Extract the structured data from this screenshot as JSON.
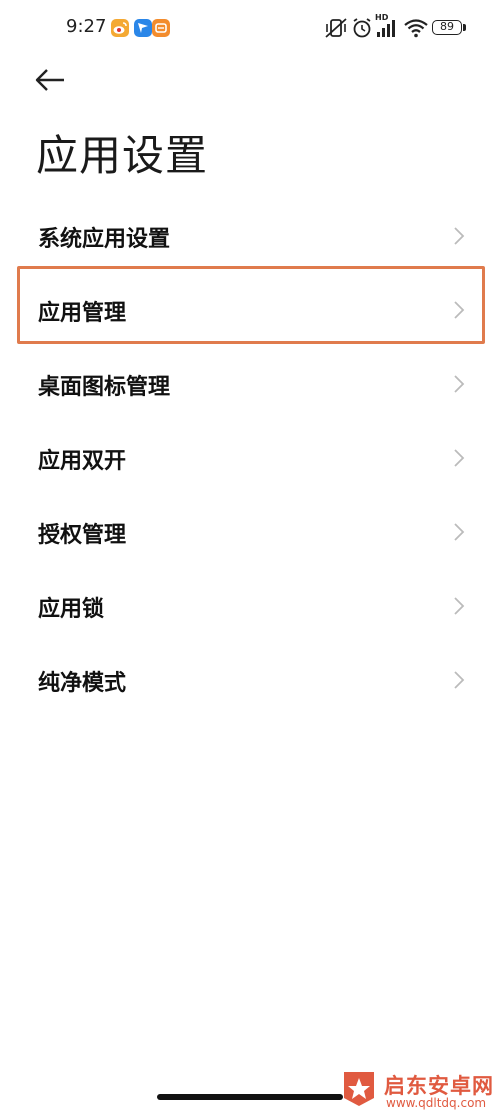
{
  "status_bar": {
    "time": "9:27",
    "battery": "89",
    "network_badge": "HD",
    "notification_icons": [
      "weibo-icon",
      "blue-app-icon",
      "orange-app-icon"
    ],
    "system_icons": [
      "vibrate-off-icon",
      "alarm-icon",
      "signal-icon",
      "wifi-icon",
      "battery-icon"
    ]
  },
  "header": {
    "back_icon": "back-arrow-icon",
    "title": "应用设置"
  },
  "menu": {
    "items": [
      {
        "label": "系统应用设置"
      },
      {
        "label": "应用管理",
        "highlighted": true
      },
      {
        "label": "桌面图标管理"
      },
      {
        "label": "应用双开"
      },
      {
        "label": "授权管理"
      },
      {
        "label": "应用锁"
      },
      {
        "label": "纯净模式"
      }
    ],
    "chevron_icon": "chevron-right-icon",
    "highlight_color": "#e07b4d"
  },
  "watermark": {
    "name": "启东安卓网",
    "url": "www.qdltdq.com",
    "color": "#e05a40"
  }
}
